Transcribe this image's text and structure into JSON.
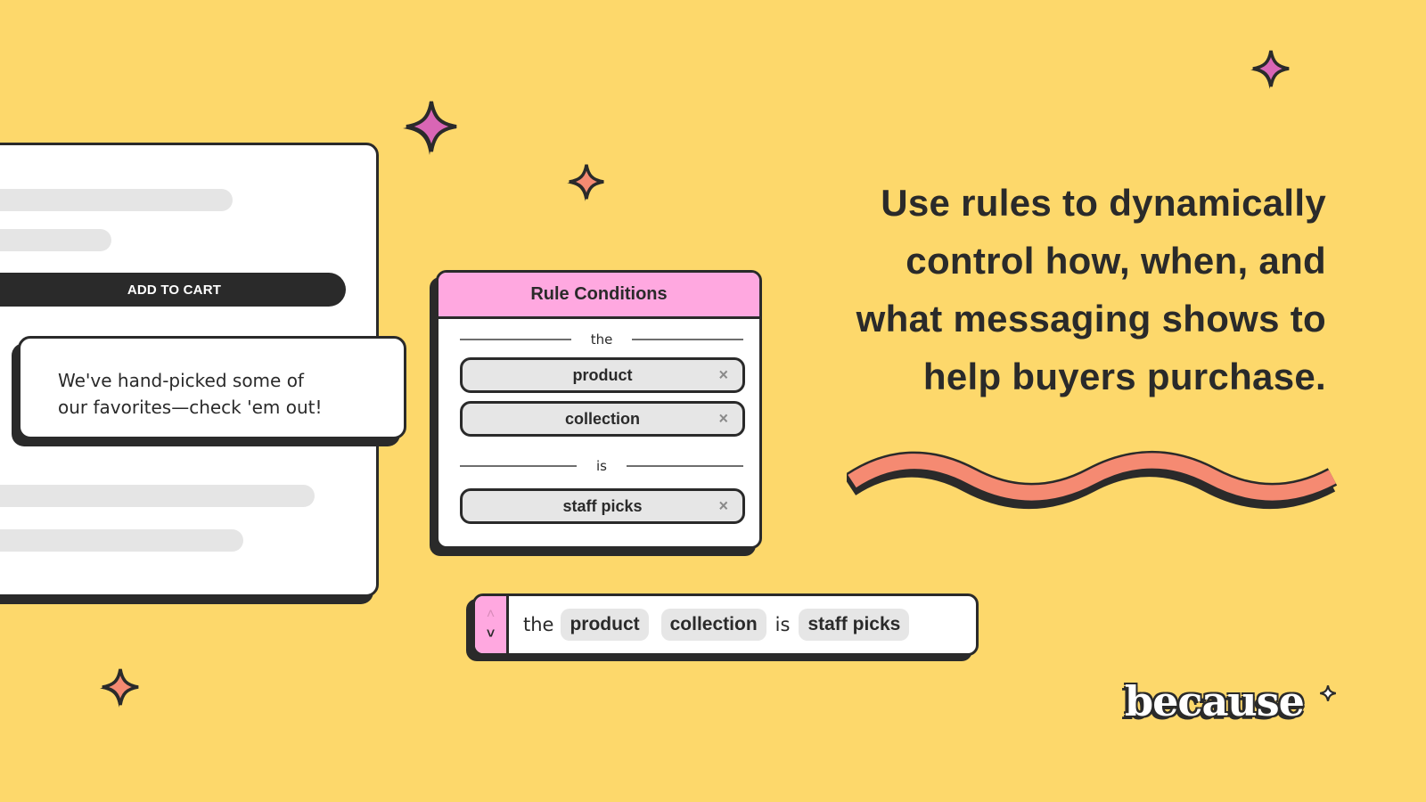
{
  "product_card": {
    "add_to_cart_label": "ADD TO CART"
  },
  "message": {
    "line1": "We've hand-picked some of",
    "line2": "our favorites—check 'em out!"
  },
  "rule_panel": {
    "title": "Rule Conditions",
    "divider_the": "the",
    "divider_is": "is",
    "chips": [
      {
        "label": "product",
        "remove_icon": "×"
      },
      {
        "label": "collection",
        "remove_icon": "×"
      },
      {
        "label": "staff picks",
        "remove_icon": "×"
      }
    ]
  },
  "rule_bar": {
    "stepper_up": "˄",
    "stepper_down": "˅",
    "word_the": "the",
    "chip_product": "product",
    "chip_collection": "collection",
    "word_is": "is",
    "chip_staff_picks": "staff picks"
  },
  "headline": {
    "line1": "Use rules to dynamically",
    "line2": "control how, when, and",
    "line3": "what messaging shows to",
    "line4": "help buyers purchase."
  },
  "logo": {
    "text": "because"
  },
  "colors": {
    "background": "#FDD86B",
    "ink": "#2A2A2A",
    "pink": "#FFA8E0",
    "magenta_sparkle": "#D966B5",
    "coral": "#F58A72",
    "chip_gray": "#E6E6E6"
  }
}
